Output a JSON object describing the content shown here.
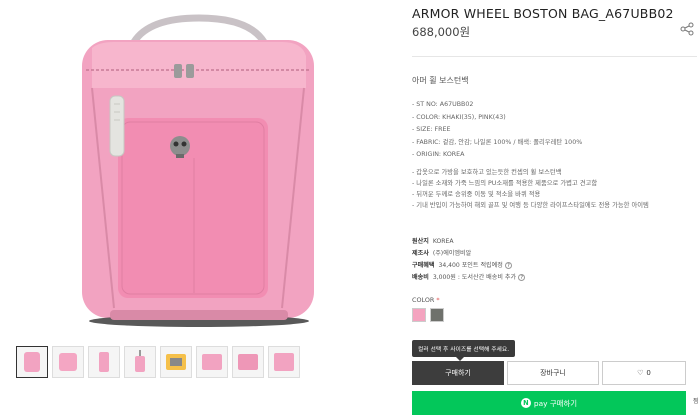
{
  "product": {
    "title": "ARMOR WHEEL BOSTON BAG_A67UBB02",
    "price": "688,000원",
    "subtitle": "아머 휠 보스턴백",
    "specs": [
      "- ST NO: A67UBB02",
      "- COLOR: KHAKI(35), PINK(43)",
      "- SIZE: FREE",
      "- FABRIC: 겉감, 안감; 나일론 100% / 배색: 폴리우레탄 100%",
      "- ORIGIN: KOREA"
    ],
    "features": [
      "- 갑옷으로 가방을 보호하고 있는듯한 컨셉의 휠 보스턴백",
      "- 나일론 소재와 가죽 느낌의 PU소재를 적용한 제품으로 가볍고 견고함",
      "- 뒤꺼운 두께로 승위중 이동 및 적소을 바퀴 적용",
      "- 기내 반입이 가능하여 해외 골프 및 여행 등 다양한 라이프스타일에도 전용 가능한 아이템"
    ]
  },
  "meta": {
    "origin_label": "원산지",
    "origin_value": "KOREA",
    "maker_label": "제조사",
    "maker_value": "(주)에이엠비알",
    "benefit_label": "구매혜택",
    "benefit_value": "34,400 포인트 적립예정",
    "shipping_label": "배송비",
    "shipping_value": "3,000원 : 도서산간 배송비 추가"
  },
  "options": {
    "color_label": "COLOR",
    "required_mark": "*",
    "swatches": [
      "#f4a3bf",
      "#6f716c"
    ]
  },
  "tooltip": "컬러 선택 후 사이즈를 선택해 주세요.",
  "buttons": {
    "buy": "구매하기",
    "cart": "장바구니",
    "like_count": "0",
    "npay_logo": "N",
    "npay_label": "pay 구매하기",
    "npay_side": "찜"
  },
  "colors": {
    "bag_pink": "#f2a3c1",
    "accent_green": "#03c75a",
    "dark_button": "#3d3d3d"
  }
}
